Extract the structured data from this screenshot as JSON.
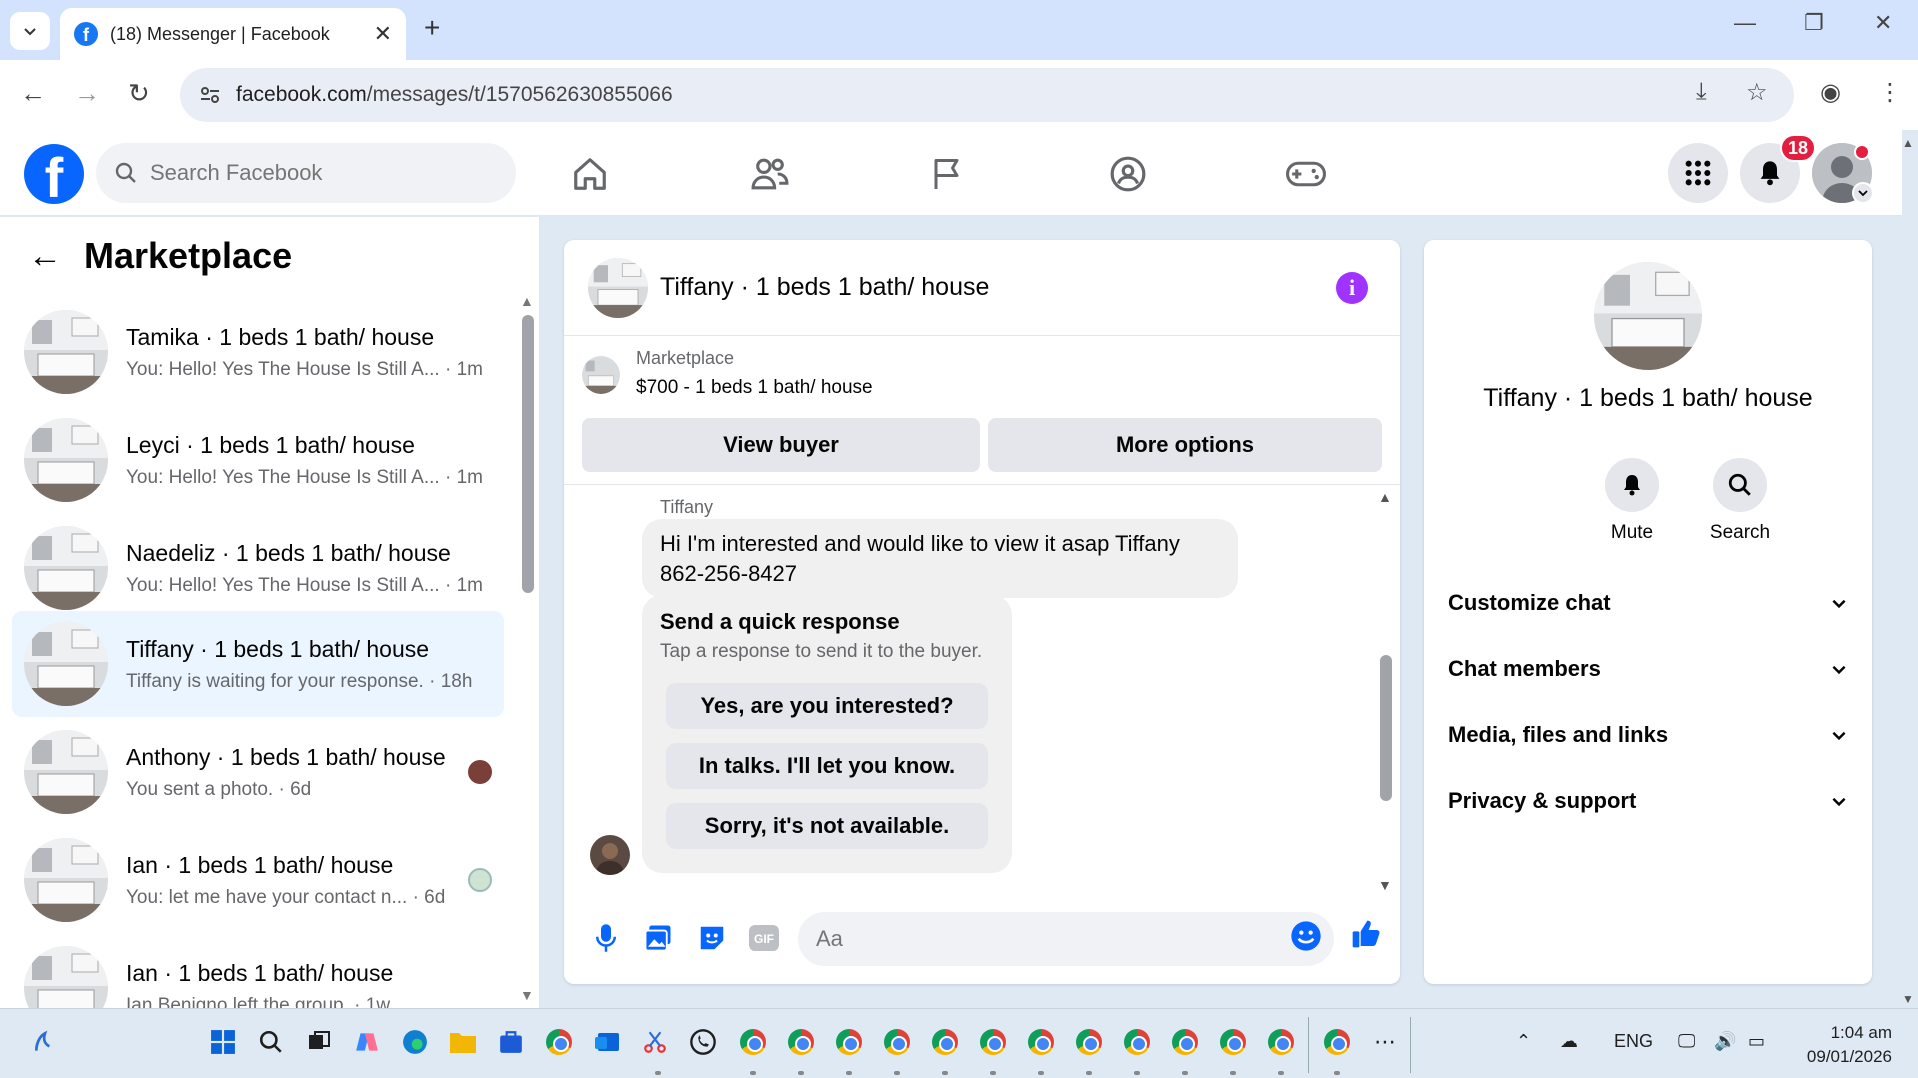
{
  "browser": {
    "tab_title": "(18) Messenger | Facebook",
    "url_host": "facebook.com",
    "url_path": "/messages/t/1570562630855066"
  },
  "fb": {
    "search_placeholder": "Search Facebook",
    "notification_count": "18",
    "brand_color": "#0866ff"
  },
  "left": {
    "title": "Marketplace",
    "conversations": [
      {
        "name": "Tamika · 1 beds 1 bath/ house",
        "preview": "You: Hello! Yes The House Is Still A... · 1m"
      },
      {
        "name": "Leyci · 1 beds 1 bath/ house",
        "preview": "You: Hello! Yes The House Is Still A... · 1m"
      },
      {
        "name": "Naedeliz · 1 beds 1 bath/ house",
        "preview": "You: Hello! Yes The House Is Still A... · 1m"
      },
      {
        "name": "Tiffany · 1 beds 1 bath/ house",
        "preview": "Tiffany is waiting for your response. · 18h"
      },
      {
        "name": "Anthony · 1 beds 1 bath/ house",
        "preview": "You sent a photo. · 6d"
      },
      {
        "name": "Ian · 1 beds 1 bath/ house",
        "preview": "You: let me have your contact n... · 6d"
      },
      {
        "name": "Ian · 1 beds 1 bath/ house",
        "preview": "Ian Benigno left the group. · 1w"
      }
    ]
  },
  "chat": {
    "title": "Tiffany · 1 beds 1 bath/ house",
    "listing_source": "Marketplace",
    "listing_desc": "$700 - 1 beds 1 bath/ house",
    "view_buyer": "View buyer",
    "more_options": "More options",
    "sender": "Tiffany",
    "message": "Hi I'm interested and would like to view it asap Tiffany 862-256-8427",
    "quick_title": "Send a quick response",
    "quick_sub": "Tap a response to send it to the buyer.",
    "quick_replies": [
      "Yes, are you interested?",
      "In talks. I'll let you know.",
      "Sorry, it's not available."
    ],
    "composer_placeholder": "Aa"
  },
  "right": {
    "name": "Tiffany · 1 beds 1 bath/ house",
    "mute": "Mute",
    "search": "Search",
    "sections": [
      "Customize chat",
      "Chat members",
      "Media, files and links",
      "Privacy & support"
    ]
  },
  "taskbar": {
    "lang": "ENG",
    "time": "1:04 am",
    "date": "09/01/2026"
  }
}
